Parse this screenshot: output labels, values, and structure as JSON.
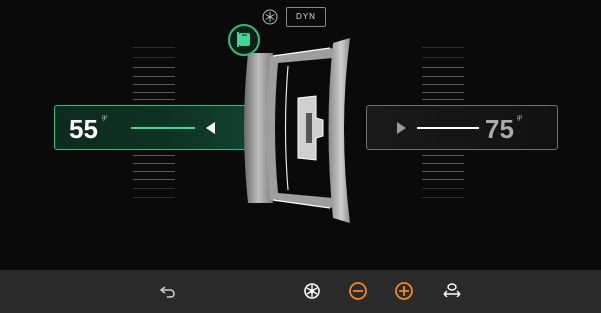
{
  "top": {
    "mode_icon": "snowflake-wheel-icon",
    "mode_label": "DYN"
  },
  "left_plane": {
    "value": "55",
    "unit": "gr",
    "arrow": "triangle-left-icon",
    "active": true
  },
  "right_plane": {
    "value": "75",
    "unit": "gr",
    "arrow": "triangle-right-icon",
    "active": false
  },
  "weight_type_icon": "adhesive-weight-icon",
  "wheel_icon": "rim-cross-section",
  "bottom_bar": {
    "items": [
      {
        "icon": "back-arrow-icon",
        "color": "#cccccc"
      },
      {
        "icon": "wheel-settings-icon",
        "color": "#ffffff"
      },
      {
        "icon": "minus-circle-icon",
        "color": "#f08a1c"
      },
      {
        "icon": "plus-circle-icon",
        "color": "#f08a1c"
      },
      {
        "icon": "wheel-width-icon",
        "color": "#ffffff"
      }
    ]
  },
  "colors": {
    "active_green": "#2dbf82",
    "accent_orange": "#f08a1c",
    "background": "#0a0a0a"
  }
}
